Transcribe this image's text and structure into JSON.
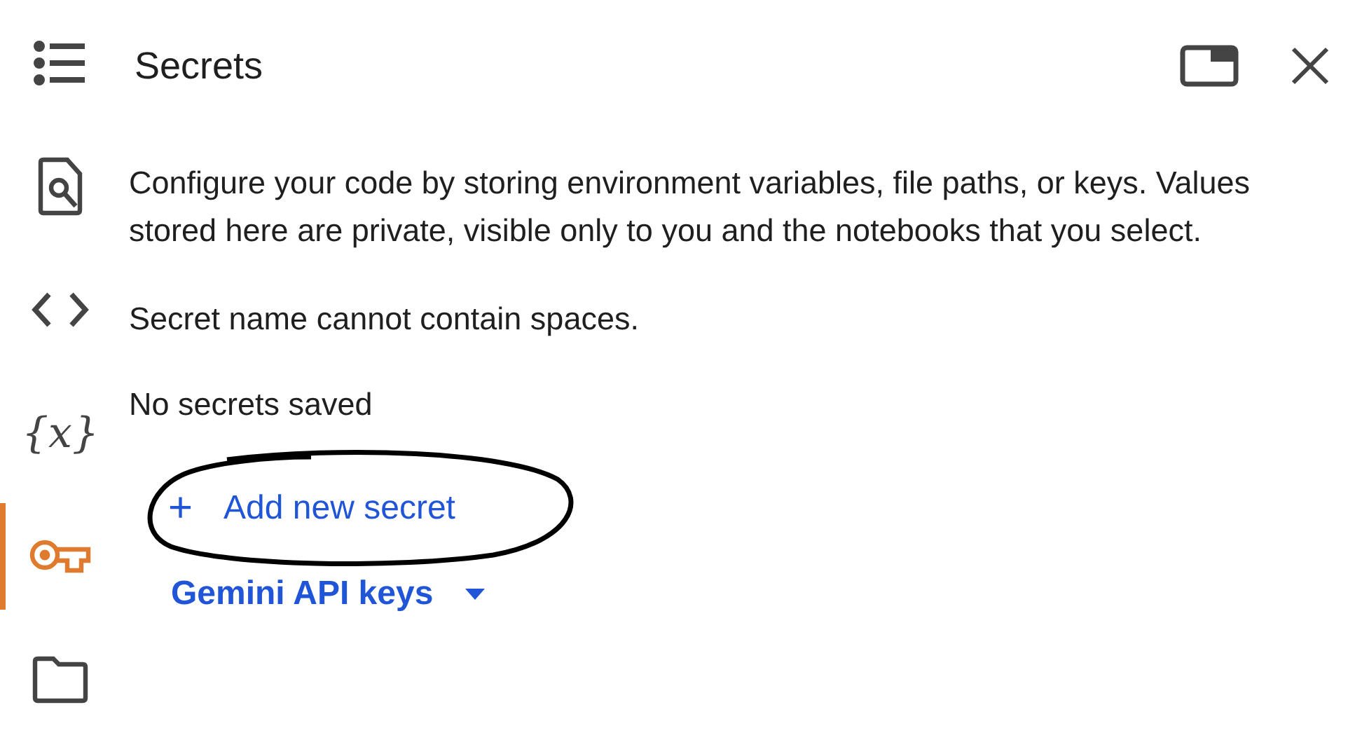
{
  "sidebar": {
    "items": [
      {
        "kind": "toc",
        "selected": false
      },
      {
        "kind": "find",
        "selected": false
      },
      {
        "kind": "code",
        "selected": false
      },
      {
        "kind": "variables",
        "label": "{x}",
        "selected": false
      },
      {
        "kind": "key",
        "selected": true
      },
      {
        "kind": "folder",
        "selected": false
      }
    ]
  },
  "panel": {
    "title": "Secrets",
    "description": "Configure your code by storing environment variables, file paths, or keys. Values stored here are private, visible only to you and the notebooks that you select.",
    "note": "Secret name cannot contain spaces.",
    "empty_message": "No secrets saved",
    "add_button": {
      "icon": "+",
      "label": "Add new secret",
      "circled": true
    },
    "dropdown": {
      "label": "Gemini API keys"
    }
  }
}
